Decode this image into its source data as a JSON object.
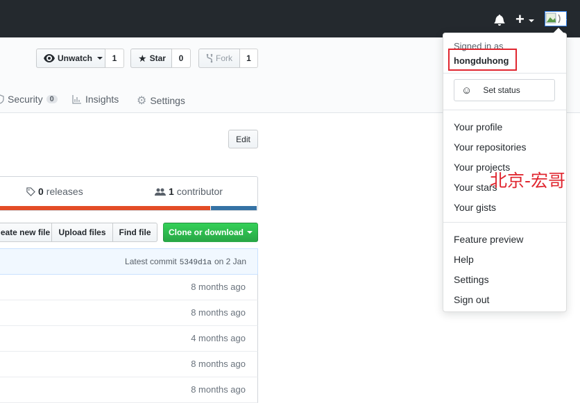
{
  "header": {
    "notifications_icon": "bell-icon",
    "new_icon": "plus-icon"
  },
  "repo_actions": {
    "watch": {
      "label": "Unwatch",
      "count": "1"
    },
    "star": {
      "label": "Star",
      "count": "0"
    },
    "fork": {
      "label": "Fork",
      "count": "1"
    }
  },
  "tabs": [
    {
      "label": "Security",
      "count": "0",
      "icon": "shield-icon"
    },
    {
      "label": "Insights",
      "icon": "graph-icon"
    },
    {
      "label": "Settings",
      "icon": "gear-icon"
    }
  ],
  "edit_label": "Edit",
  "stats": {
    "releases_count": "0",
    "releases_label": "releases",
    "contributors_count": "1",
    "contributors_label": "contributor"
  },
  "language_colors": {
    "primary": "#e34c26",
    "secondary": "#3572A5"
  },
  "language_split": {
    "primary_fraction": 0.82
  },
  "file_buttons": {
    "create": "eate new file",
    "upload": "Upload files",
    "find": "Find file",
    "clone": "Clone or download"
  },
  "commit": {
    "prefix": "Latest commit",
    "sha": "5349d1a",
    "date": "on 2 Jan"
  },
  "file_rows": [
    {
      "age": "8 months ago"
    },
    {
      "age": "8 months ago"
    },
    {
      "age": "4 months ago"
    },
    {
      "age": "8 months ago"
    },
    {
      "age": "8 months ago"
    }
  ],
  "user_menu": {
    "signed_in_as": "Signed in as",
    "username": "hongduhong",
    "set_status": "Set status",
    "items_group1": [
      "Your profile",
      "Your repositories",
      "Your projects",
      "Your stars",
      "Your gists"
    ],
    "items_group2": [
      "Feature preview",
      "Help",
      "Settings",
      "Sign out"
    ]
  },
  "watermark": "北京-宏哥",
  "colors": {
    "highlight": "#e0262f",
    "watermark": "#e0262f",
    "green": "#28a745"
  }
}
